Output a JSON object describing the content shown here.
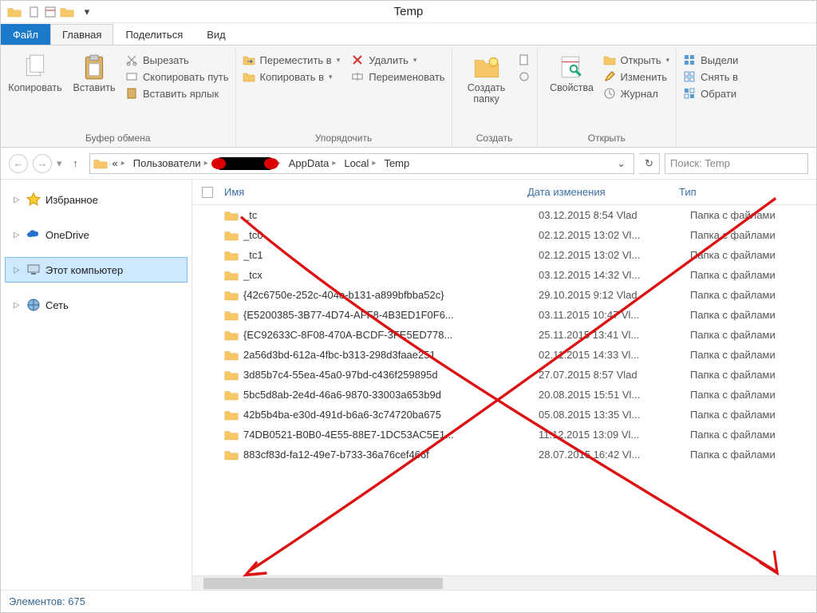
{
  "title": "Temp",
  "tabs": {
    "file": "Файл",
    "home": "Главная",
    "share": "Поделиться",
    "view": "Вид"
  },
  "ribbon": {
    "clipboard": {
      "label": "Буфер обмена",
      "copy": "Копировать",
      "paste": "Вставить",
      "cut": "Вырезать",
      "copypath": "Скопировать путь",
      "pasteshortcut": "Вставить ярлык"
    },
    "organize": {
      "label": "Упорядочить",
      "moveto": "Переместить в",
      "copyto": "Копировать в",
      "delete": "Удалить",
      "rename": "Переименовать"
    },
    "new": {
      "label": "Создать",
      "newfolder": "Создать\nпапку"
    },
    "open": {
      "label": "Открыть",
      "properties": "Свойства",
      "open": "Открыть",
      "edit": "Изменить",
      "history": "Журнал"
    },
    "select": {
      "label": "",
      "selectall": "Выдели",
      "selectnone": "Снять в",
      "invert": "Обрати"
    }
  },
  "breadcrumb": [
    "Пользователи",
    "",
    "AppData",
    "Local",
    "Temp"
  ],
  "search_placeholder": "Поиск: Temp",
  "tree": {
    "favorites": "Избранное",
    "onedrive": "OneDrive",
    "thispc": "Этот компьютер",
    "network": "Сеть"
  },
  "columns": {
    "name": "Имя",
    "date": "Дата изменения",
    "type": "Тип"
  },
  "rows": [
    {
      "name": "_tc",
      "date": "03.12.2015 8:54 Vlad",
      "type": "Папка с файлами"
    },
    {
      "name": "_tc0",
      "date": "02.12.2015 13:02 Vl...",
      "type": "Папка с файлами"
    },
    {
      "name": "_tc1",
      "date": "02.12.2015 13:02 Vl...",
      "type": "Папка с файлами"
    },
    {
      "name": "_tcx",
      "date": "03.12.2015 14:32 Vl...",
      "type": "Папка с файлами"
    },
    {
      "name": "{42c6750e-252c-404e-b131-a899bfbba52c}",
      "date": "29.10.2015 9:12 Vlad",
      "type": "Папка с файлами"
    },
    {
      "name": "{E5200385-3B77-4D74-AFF8-4B3ED1F0F6...",
      "date": "03.11.2015 10:47 Vl...",
      "type": "Папка с файлами"
    },
    {
      "name": "{EC92633C-8F08-470A-BCDF-3FE5ED778...",
      "date": "25.11.2015 13:41 Vl...",
      "type": "Папка с файлами"
    },
    {
      "name": "2a56d3bd-612a-4fbc-b313-298d3faae251",
      "date": "02.11.2015 14:33 Vl...",
      "type": "Папка с файлами"
    },
    {
      "name": "3d85b7c4-55ea-45a0-97bd-c436f259895d",
      "date": "27.07.2015 8:57 Vlad",
      "type": "Папка с файлами"
    },
    {
      "name": "5bc5d8ab-2e4d-46a6-9870-33003a653b9d",
      "date": "20.08.2015 15:51 Vl...",
      "type": "Папка с файлами"
    },
    {
      "name": "42b5b4ba-e30d-491d-b6a6-3c74720ba675",
      "date": "05.08.2015 13:35 Vl...",
      "type": "Папка с файлами"
    },
    {
      "name": "74DB0521-B0B0-4E55-88E7-1DC53AC5E1...",
      "date": "11.12.2015 13:09 Vl...",
      "type": "Папка с файлами"
    },
    {
      "name": "883cf83d-fa12-49e7-b733-36a76cef466f",
      "date": "28.07.2015 16:42 Vl...",
      "type": "Папка с файлами"
    }
  ],
  "status": "Элементов: 675"
}
